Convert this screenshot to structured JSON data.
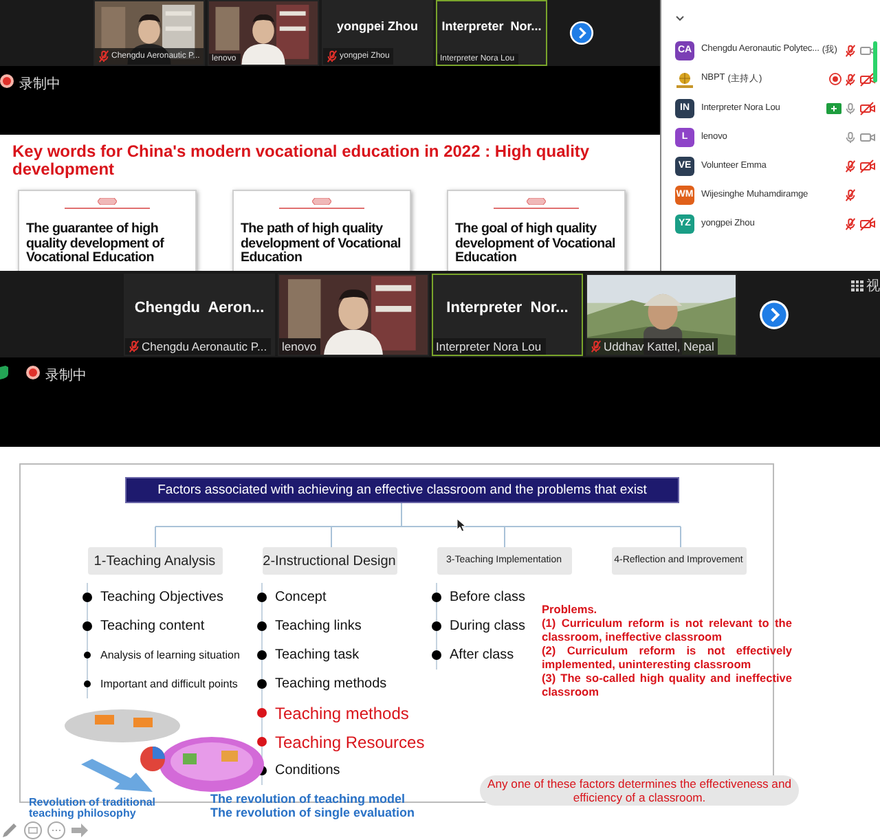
{
  "top_meeting": {
    "tiles": [
      {
        "kind": "video",
        "label": "Chengdu Aeronautic P...",
        "muted": true,
        "speaking": false
      },
      {
        "kind": "video",
        "label": "lenovo",
        "muted": false,
        "speaking": false
      },
      {
        "kind": "name",
        "display_name": "yongpei Zhou",
        "label": "yongpei Zhou",
        "muted": true,
        "speaking": false
      },
      {
        "kind": "name",
        "display_name": "Interpreter  Nor...",
        "label": "Interpreter Nora Lou",
        "muted": false,
        "speaking": true
      }
    ],
    "recording_label": "录制中"
  },
  "keyword_slide": {
    "title": "Key words for China's modern vocational education in 2022 : High quality development",
    "cards": [
      "The guarantee of high quality development of Vocational Education",
      "The path of high quality development of Vocational Education",
      "The goal of high quality development of Vocational Education"
    ]
  },
  "participants": [
    {
      "initials": "CA",
      "color": "#7b3fb5",
      "name": "Chengdu Aeronautic Polytec...",
      "role": "(我)",
      "recording": false,
      "interpreting": false,
      "mic_muted": true,
      "video_off": false
    },
    {
      "name": "NBPT",
      "role": "(主持人)",
      "recording": true,
      "interpreting": false,
      "mic_muted": true,
      "video_off": true
    },
    {
      "initials": "IN",
      "color": "#2c3e55",
      "name": "Interpreter Nora Lou",
      "recording": false,
      "interpreting": true,
      "mic_muted": false,
      "video_off": true
    },
    {
      "initials": "L",
      "color": "#8e44c8",
      "name": "lenovo",
      "recording": false,
      "interpreting": false,
      "mic_muted": false,
      "video_off": false
    },
    {
      "initials": "VE",
      "color": "#2c3e55",
      "name": "Volunteer Emma",
      "recording": false,
      "interpreting": false,
      "mic_muted": true,
      "video_off": true
    },
    {
      "initials": "WM",
      "color": "#e0601a",
      "name": "Wijesinghe Muhamdiramge",
      "recording": false,
      "interpreting": false,
      "mic_muted": true
    },
    {
      "initials": "YZ",
      "color": "#1a9e86",
      "name": "yongpei Zhou",
      "recording": false,
      "interpreting": false,
      "mic_muted": true,
      "video_off": true
    }
  ],
  "bottom_meeting": {
    "tiles": [
      {
        "kind": "name",
        "display_name": "Chengdu  Aeron...",
        "label": "Chengdu Aeronautic P...",
        "muted": true,
        "speaking": false
      },
      {
        "kind": "video",
        "label": "lenovo",
        "muted": false,
        "speaking": false
      },
      {
        "kind": "name",
        "display_name": "Interpreter  Nor...",
        "label": "Interpreter Nora Lou",
        "muted": false,
        "speaking": true
      },
      {
        "kind": "video",
        "label": "Uddhav Kattel, Nepal",
        "muted": true,
        "speaking": false
      }
    ],
    "recording_label": "录制中",
    "view_label": "视"
  },
  "factors_slide": {
    "title": "Factors associated with achieving an effective classroom and the problems that exist",
    "columns": [
      {
        "heading": "1-Teaching Analysis",
        "items": [
          {
            "text": "Teaching Objectives",
            "kind": "normal"
          },
          {
            "text": "Teaching content",
            "kind": "normal"
          },
          {
            "text": "Analysis of learning situation",
            "kind": "small"
          },
          {
            "text": "Important and difficult points",
            "kind": "small"
          }
        ]
      },
      {
        "heading": "2-Instructional Design",
        "items": [
          {
            "text": "Concept",
            "kind": "normal"
          },
          {
            "text": "Teaching links",
            "kind": "normal"
          },
          {
            "text": "Teaching task",
            "kind": "normal"
          },
          {
            "text": "Teaching methods",
            "kind": "normal"
          },
          {
            "text": "Teaching methods",
            "kind": "emphasis"
          },
          {
            "text": "Teaching Resources",
            "kind": "emphasis"
          },
          {
            "text": "Conditions",
            "kind": "normal"
          }
        ]
      },
      {
        "heading": "3-Teaching Implementation",
        "items": [
          {
            "text": "Before class",
            "kind": "normal"
          },
          {
            "text": "During class",
            "kind": "normal"
          },
          {
            "text": "After class",
            "kind": "normal"
          }
        ]
      },
      {
        "heading": "4-Reflection and Improvement"
      }
    ],
    "problems": [
      "Problems.",
      "(1) Curriculum reform is not relevant to the classroom, ineffective classroom",
      "(2) Curriculum reform is not effectively implemented, uninteresting classroom",
      "(3) The so-called high quality and ineffective classroom"
    ],
    "note": "Any one of these factors determines the effectiveness and efficiency of a classroom.",
    "left_caption": "Revolution of traditional teaching philosophy",
    "captions": [
      "The revolution of teaching model",
      "The revolution of single evaluation"
    ]
  }
}
